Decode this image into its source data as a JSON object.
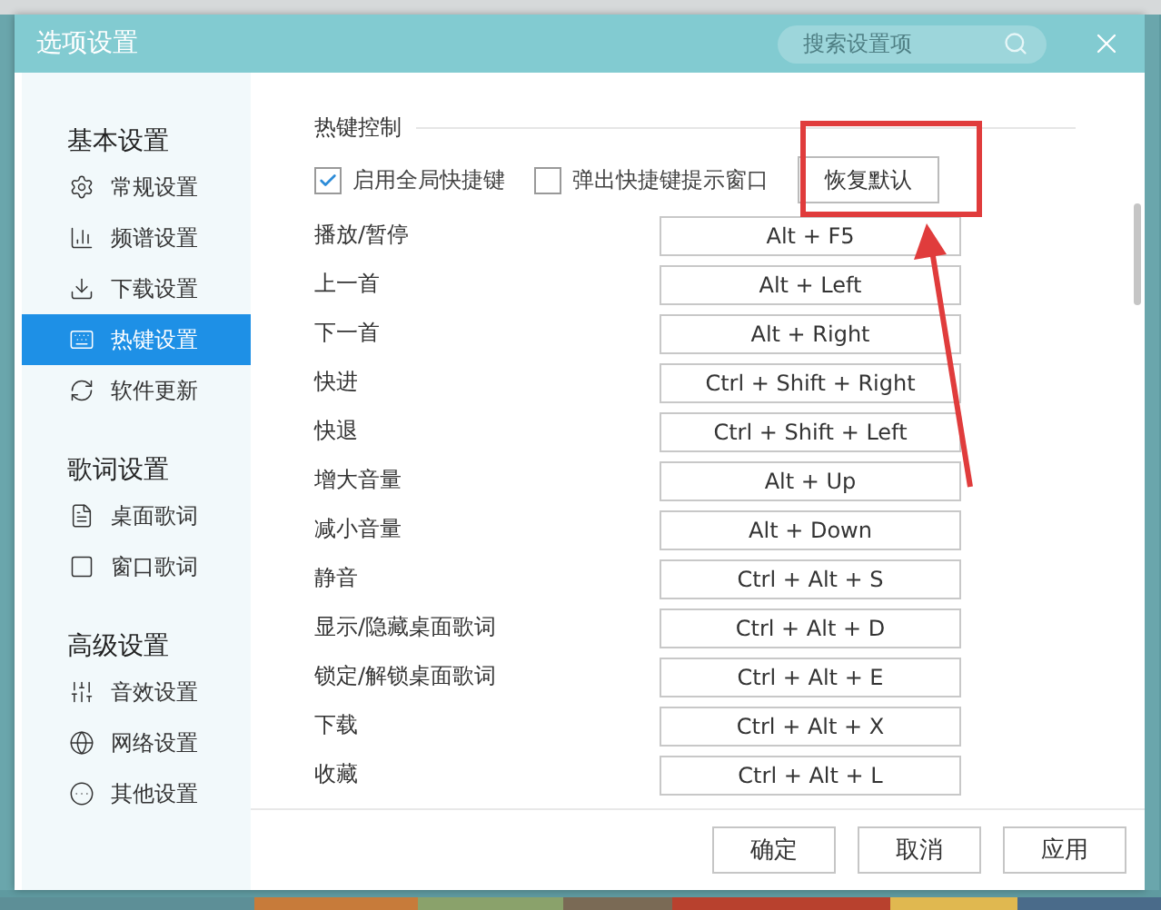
{
  "window": {
    "title": "选项设置",
    "search": {
      "placeholder": "搜索设置项"
    }
  },
  "sidebar": [
    {
      "heading": "基本设置",
      "items": [
        {
          "label": "常规设置",
          "selected": false
        },
        {
          "label": "频谱设置",
          "selected": false
        },
        {
          "label": "下载设置",
          "selected": false
        },
        {
          "label": "热键设置",
          "selected": true
        },
        {
          "label": "软件更新",
          "selected": false
        }
      ]
    },
    {
      "heading": "歌词设置",
      "items": [
        {
          "label": "桌面歌词",
          "selected": false
        },
        {
          "label": "窗口歌词",
          "selected": false
        }
      ]
    },
    {
      "heading": "高级设置",
      "items": [
        {
          "label": "音效设置",
          "selected": false
        },
        {
          "label": "网络设置",
          "selected": false
        },
        {
          "label": "其他设置",
          "selected": false
        }
      ]
    }
  ],
  "section": {
    "heading": "热键控制",
    "options": [
      {
        "label": "启用全局快捷键",
        "checked": true
      },
      {
        "label": "弹出快捷键提示窗口",
        "checked": false
      }
    ],
    "reset_button": "恢复默认"
  },
  "hotkeys": [
    {
      "label": "播放/暂停",
      "value": "Alt + F5"
    },
    {
      "label": "上一首",
      "value": "Alt + Left"
    },
    {
      "label": "下一首",
      "value": "Alt + Right"
    },
    {
      "label": "快进",
      "value": "Ctrl + Shift + Right"
    },
    {
      "label": "快退",
      "value": "Ctrl + Shift + Left"
    },
    {
      "label": "增大音量",
      "value": "Alt + Up"
    },
    {
      "label": "减小音量",
      "value": "Alt + Down"
    },
    {
      "label": "静音",
      "value": "Ctrl + Alt + S"
    },
    {
      "label": "显示/隐藏桌面歌词",
      "value": "Ctrl + Alt + D"
    },
    {
      "label": "锁定/解锁桌面歌词",
      "value": "Ctrl + Alt + E"
    },
    {
      "label": "下载",
      "value": "Ctrl + Alt + X"
    },
    {
      "label": "收藏",
      "value": "Ctrl + Alt + L"
    }
  ],
  "footer_buttons": [
    "确定",
    "取消",
    "应用"
  ]
}
